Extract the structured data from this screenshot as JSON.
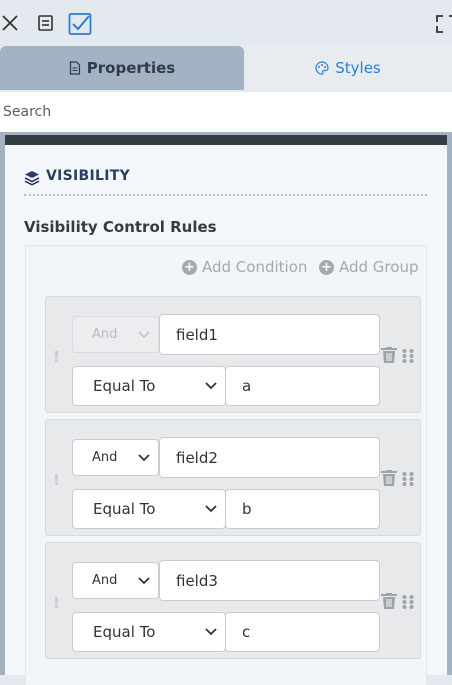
{
  "toolbar": {
    "icons": [
      "close-icon",
      "form-icon",
      "checkbox-checked-icon",
      "expand-icon"
    ],
    "accent": "#2a7fd4"
  },
  "tabs": {
    "properties": "Properties",
    "styles": "Styles"
  },
  "search": {
    "placeholder": "Search",
    "value": ""
  },
  "visibility": {
    "title": "VISIBILITY",
    "rules_label": "Visibility Control Rules",
    "add_condition": "Add Condition",
    "add_group": "Add Group",
    "conditions": [
      {
        "logic": "And",
        "logic_disabled": true,
        "field": "field1",
        "operator": "Equal To",
        "value": "a"
      },
      {
        "logic": "And",
        "logic_disabled": false,
        "field": "field2",
        "operator": "Equal To",
        "value": "b"
      },
      {
        "logic": "And",
        "logic_disabled": false,
        "field": "field3",
        "operator": "Equal To",
        "value": "c"
      }
    ]
  }
}
